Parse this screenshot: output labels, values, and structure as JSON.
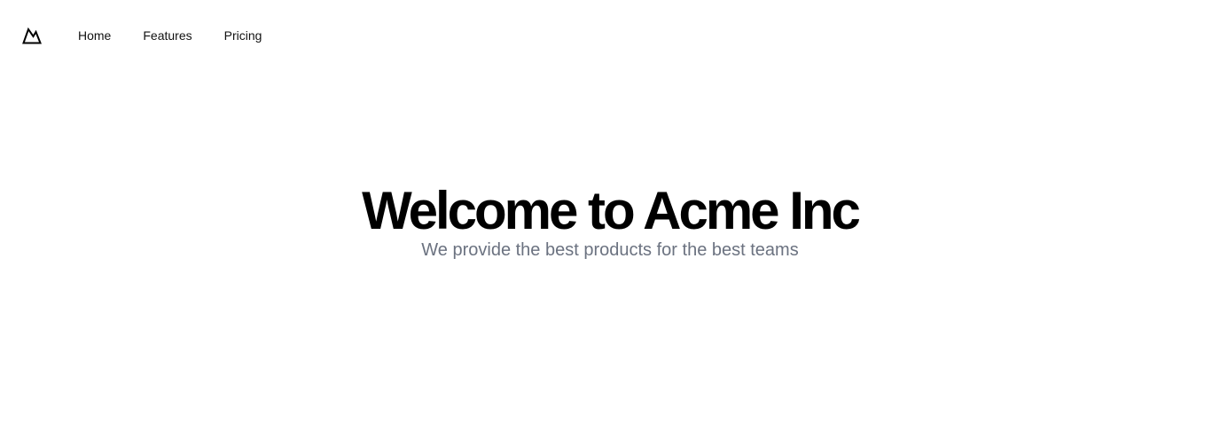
{
  "nav": {
    "logo_icon": "mountain-logo-icon",
    "links": [
      {
        "label": "Home"
      },
      {
        "label": "Features"
      },
      {
        "label": "Pricing"
      }
    ]
  },
  "hero": {
    "title": "Welcome to Acme Inc",
    "subtitle": "We provide the best products for the best teams"
  },
  "colors": {
    "background": "#ffffff",
    "title": "#000000",
    "subtitle": "#6b7280",
    "nav_text": "#111111"
  }
}
